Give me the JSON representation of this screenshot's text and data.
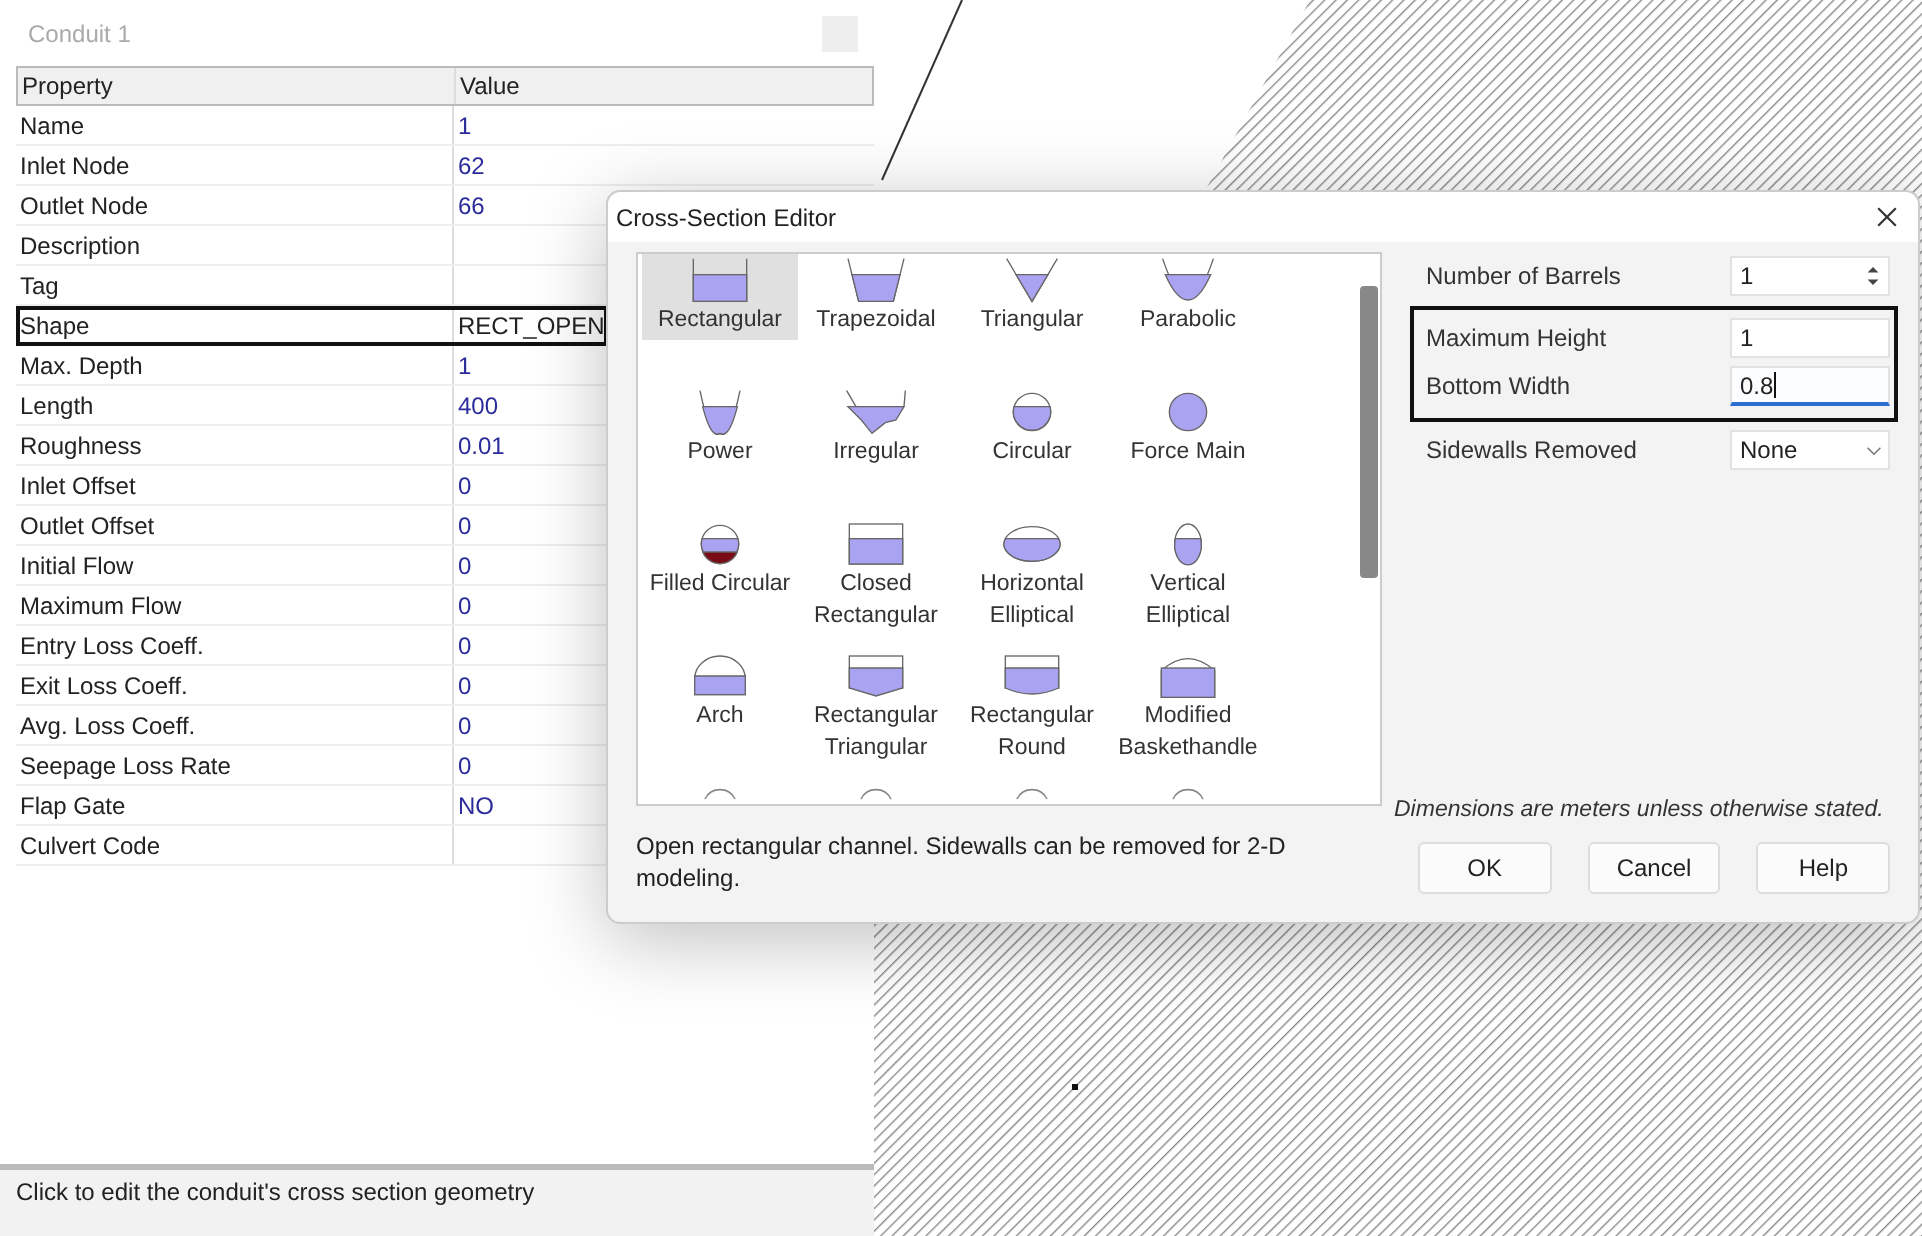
{
  "panel": {
    "title": "Conduit 1",
    "columns": [
      "Property",
      "Value"
    ],
    "rows": [
      {
        "property": "Name",
        "value": "1",
        "selected": false
      },
      {
        "property": "Inlet Node",
        "value": "62",
        "selected": false
      },
      {
        "property": "Outlet Node",
        "value": "66",
        "selected": false
      },
      {
        "property": "Description",
        "selected": false
      },
      {
        "property": "Tag",
        "selected": false
      },
      {
        "property": "Shape",
        "value": "RECT_OPEN",
        "selected": true
      },
      {
        "property": "Max. Depth",
        "value": "1",
        "selected": false
      },
      {
        "property": "Length",
        "value": "400",
        "selected": false
      },
      {
        "property": "Roughness",
        "value": "0.01",
        "selected": false
      },
      {
        "property": "Inlet Offset",
        "value": "0",
        "selected": false
      },
      {
        "property": "Outlet Offset",
        "value": "0",
        "selected": false
      },
      {
        "property": "Initial Flow",
        "value": "0",
        "selected": false
      },
      {
        "property": "Maximum Flow",
        "value": "0",
        "selected": false
      },
      {
        "property": "Entry Loss Coeff.",
        "value": "0",
        "selected": false
      },
      {
        "property": "Exit Loss Coeff.",
        "value": "0",
        "selected": false
      },
      {
        "property": "Avg. Loss Coeff.",
        "value": "0",
        "selected": false
      },
      {
        "property": "Seepage Loss Rate",
        "value": "0",
        "selected": false
      },
      {
        "property": "Flap Gate",
        "value": "NO",
        "selected": false
      },
      {
        "property": "Culvert Code",
        "selected": false
      }
    ],
    "status": "Click to edit the conduit's cross section geometry"
  },
  "dialog": {
    "title": "Cross-Section Editor",
    "shapes": [
      {
        "label": "Rectangular",
        "kind": "rect_open",
        "selected": true
      },
      {
        "label": "Trapezoidal",
        "kind": "trapezoidal",
        "selected": false
      },
      {
        "label": "Triangular",
        "kind": "triangular",
        "selected": false
      },
      {
        "label": "Parabolic",
        "kind": "parabolic",
        "selected": false
      },
      {
        "label": "Power",
        "kind": "power",
        "selected": false
      },
      {
        "label": "Irregular",
        "kind": "irregular",
        "selected": false
      },
      {
        "label": "Circular",
        "kind": "circular",
        "selected": false
      },
      {
        "label": "Force Main",
        "kind": "force_main",
        "selected": false
      },
      {
        "label": "Filled Circular",
        "kind": "filled_circular",
        "selected": false
      },
      {
        "label": "Closed Rectangular",
        "kind": "rect_closed",
        "selected": false
      },
      {
        "label": "Horizontal Elliptical",
        "kind": "horiz_ellipse",
        "selected": false
      },
      {
        "label": "Vertical Elliptical",
        "kind": "vert_ellipse",
        "selected": false
      },
      {
        "label": "Arch",
        "kind": "arch",
        "selected": false
      },
      {
        "label": "Rectangular Triangular",
        "kind": "rect_triangular",
        "selected": false
      },
      {
        "label": "Rectangular Round",
        "kind": "rect_round",
        "selected": false
      },
      {
        "label": "Modified Baskethandle",
        "kind": "basket",
        "selected": false
      },
      {
        "kind": "cut",
        "selected": false
      },
      {
        "kind": "cut",
        "selected": false
      },
      {
        "kind": "cut",
        "selected": false
      },
      {
        "kind": "cut",
        "selected": false
      }
    ],
    "description": "Open rectangular channel. Sidewalls can be removed for 2-D modeling.",
    "fields": [
      {
        "label": "Number of Barrels",
        "value": "1",
        "kind": "spinner",
        "highlighted": false,
        "focused": false
      },
      {
        "label": "Maximum Height",
        "value": "1",
        "kind": "text",
        "highlighted": true,
        "focused": false
      },
      {
        "label": "Bottom Width",
        "value": "0.8",
        "kind": "text",
        "highlighted": true,
        "focused": true
      },
      {
        "label": "Sidewalls Removed",
        "value": "None",
        "kind": "dropdown",
        "highlighted": false,
        "focused": false
      }
    ],
    "note": "Dimensions are meters unless otherwise stated.",
    "buttons": [
      "OK",
      "Cancel",
      "Help"
    ]
  }
}
